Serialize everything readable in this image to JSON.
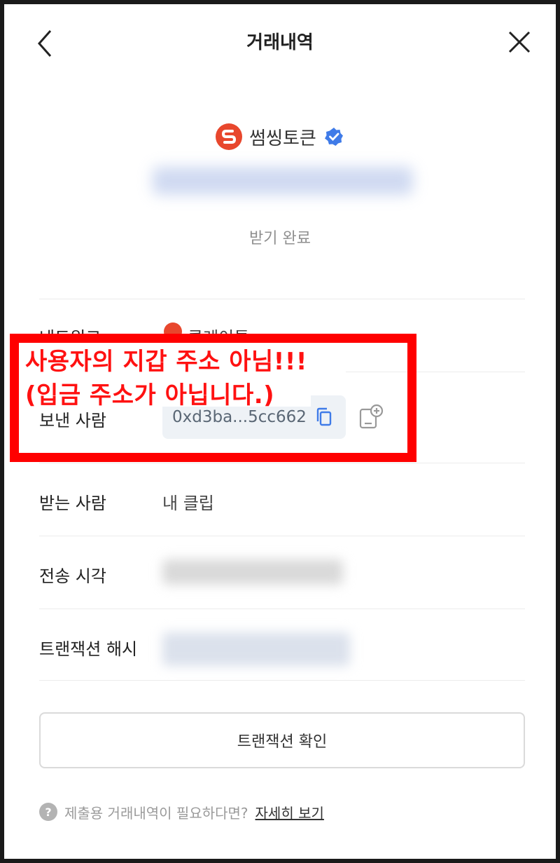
{
  "header": {
    "title": "거래내역"
  },
  "token": {
    "name": "썸씽토큰",
    "logo_letter": "S"
  },
  "status": "받기 완료",
  "rows": {
    "network": {
      "label": "네트워크",
      "value": "클레이튼"
    },
    "sender": {
      "label": "보낸 사람",
      "address": "0xd3ba...5cc662"
    },
    "receiver": {
      "label": "받는 사람",
      "value": "내 클립"
    },
    "time": {
      "label": "전송 시각"
    },
    "hash": {
      "label": "트랜잭션 해시"
    }
  },
  "confirm_button": "트랜잭션 확인",
  "help": {
    "text": "제출용 거래내역이 필요하다면?",
    "link": "자세히 보기",
    "icon": "?"
  },
  "annotation": {
    "line1": "사용자의 지갑 주소 아님!!!",
    "line2": "(입금 주소가 아닙니다.)",
    "color": "#ff0000"
  }
}
